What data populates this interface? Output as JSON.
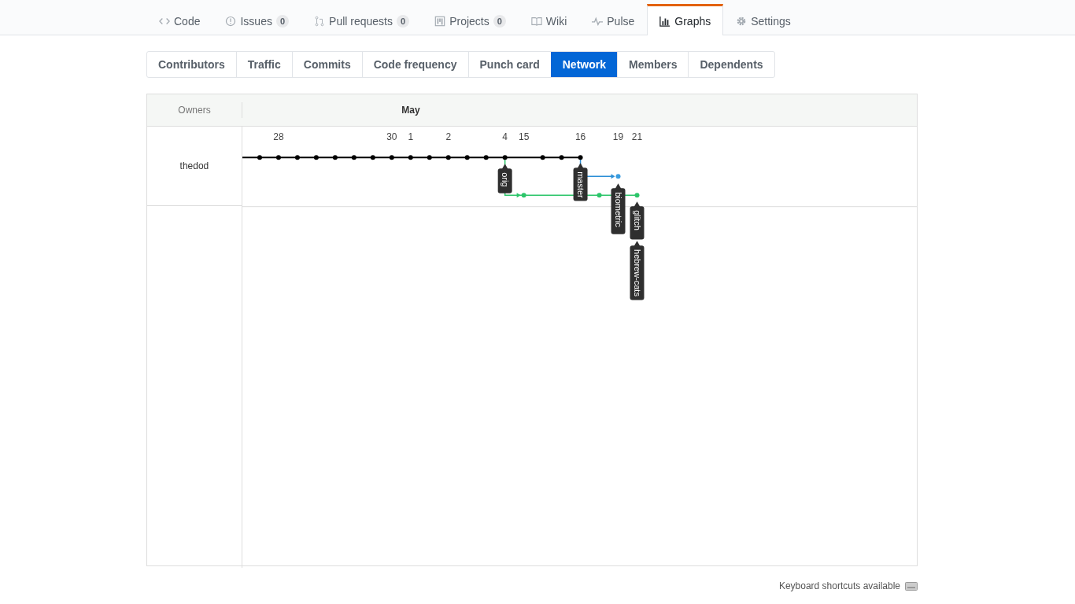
{
  "repo_tabs": [
    {
      "label": "Code",
      "selected": false
    },
    {
      "label": "Issues",
      "counter": "0",
      "selected": false
    },
    {
      "label": "Pull requests",
      "counter": "0",
      "selected": false
    },
    {
      "label": "Projects",
      "counter": "0",
      "selected": false
    },
    {
      "label": "Wiki",
      "selected": false
    },
    {
      "label": "Pulse",
      "selected": false
    },
    {
      "label": "Graphs",
      "selected": true
    },
    {
      "label": "Settings",
      "selected": false
    }
  ],
  "graph_tabs": [
    {
      "label": "Contributors",
      "selected": false
    },
    {
      "label": "Traffic",
      "selected": false
    },
    {
      "label": "Commits",
      "selected": false
    },
    {
      "label": "Code frequency",
      "selected": false
    },
    {
      "label": "Punch card",
      "selected": false
    },
    {
      "label": "Network",
      "selected": true
    },
    {
      "label": "Members",
      "selected": false
    },
    {
      "label": "Dependents",
      "selected": false
    }
  ],
  "network": {
    "owners_heading": "Owners",
    "month": "May",
    "dates": [
      "28",
      "30",
      "1",
      "2",
      "4",
      "15",
      "16",
      "19",
      "21"
    ],
    "owners": [
      "thedod"
    ],
    "branch_labels": [
      "orig",
      "master",
      "biometric",
      "glitch",
      "hebrew-cats"
    ]
  },
  "footer": {
    "shortcuts": "Keyboard shortcuts available"
  }
}
